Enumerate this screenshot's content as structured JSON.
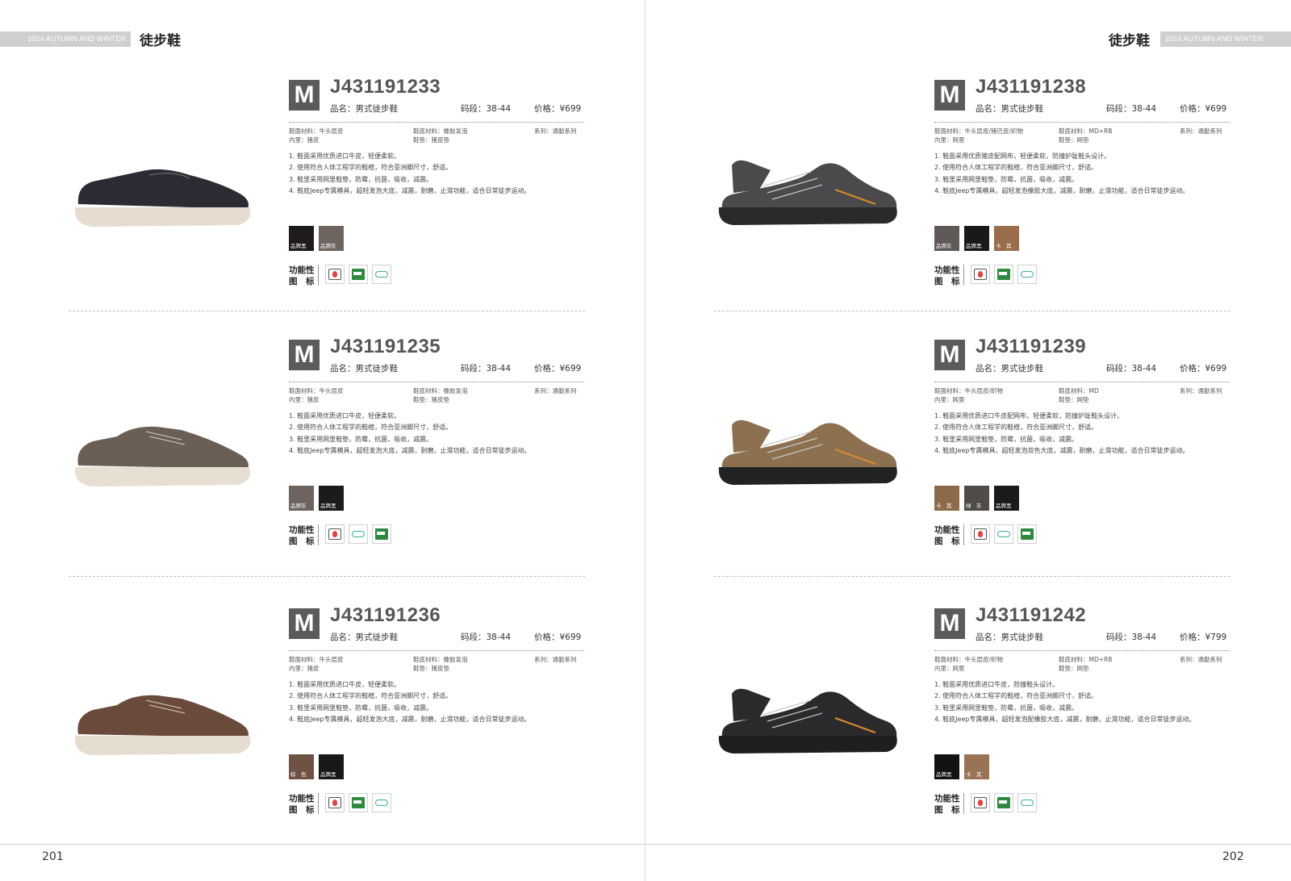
{
  "header": {
    "season_label": "2024 AUTUMN AND WINTER",
    "category_title": "徒步鞋"
  },
  "pages": {
    "left": {
      "number": "201"
    },
    "right": {
      "number": "202"
    }
  },
  "products": [
    {
      "badge": "M",
      "code": "J431191233",
      "name": "品名：男式徒步鞋",
      "size": "码段：38-44",
      "price": "价格：¥699",
      "upper": "鞋面材料：牛头层皮",
      "lining": "内里：猪皮",
      "sole": "鞋底材料：橡胶发泡",
      "insole": "鞋垫：猪皮垫",
      "series": "系列：通勤系列",
      "features": [
        "1. 鞋面采用优质进口牛皮，轻便柔软。",
        "2. 使用符合人体工程学的鞋楦，符合亚洲脚尺寸，舒适。",
        "3. 鞋里采用网里鞋垫，防霉，抗菌，吸收，减震。",
        "4. 鞋底Jeep专属模具，超轻发泡大底，减震，耐磨，止滑功能，适合日常徒步运动。"
      ],
      "colors": [
        {
          "label": "品牌黑",
          "hex": "#1f1b1d"
        },
        {
          "label": "品牌灰",
          "hex": "#6f6560"
        }
      ],
      "function_label": [
        "功能性",
        "图　标"
      ],
      "icons": [
        "anti-icon",
        "aegis-icon",
        "light-icon"
      ],
      "shoe": {
        "upper": "#2b2c33",
        "sole": "#e6ddd0",
        "style": "loafer"
      }
    },
    {
      "badge": "M",
      "code": "J431191235",
      "name": "品名：男式徒步鞋",
      "size": "码段：38-44",
      "price": "价格：¥699",
      "upper": "鞋面材料：牛头层皮",
      "lining": "内里：猪皮",
      "sole": "鞋底材料：橡胶发泡",
      "insole": "鞋垫：猪皮垫",
      "series": "系列：通勤系列",
      "features": [
        "1. 鞋面采用优质进口牛皮，轻便柔软。",
        "2. 使用符合人体工程学的鞋楦，符合亚洲脚尺寸，舒适。",
        "3. 鞋里采用网里鞋垫，防霉，抗菌，吸收，减震。",
        "4. 鞋底Jeep专属模具，超轻发泡大底，减震，耐磨，止滑功能，适合日常徒步运动。"
      ],
      "colors": [
        {
          "label": "品牌灰",
          "hex": "#6d6460"
        },
        {
          "label": "品牌黑",
          "hex": "#1c1a1c"
        }
      ],
      "function_label": [
        "功能性",
        "图　标"
      ],
      "icons": [
        "anti-icon",
        "light-icon",
        "aegis-icon"
      ],
      "shoe": {
        "upper": "#6b5f55",
        "sole": "#e7dfd2",
        "style": "lace"
      }
    },
    {
      "badge": "M",
      "code": "J431191236",
      "name": "品名：男式徒步鞋",
      "size": "码段：38-44",
      "price": "价格：¥699",
      "upper": "鞋面材料：牛头层皮",
      "lining": "内里：猪皮",
      "sole": "鞋底材料：橡胶发泡",
      "insole": "鞋垫：猪皮垫",
      "series": "系列：通勤系列",
      "features": [
        "1. 鞋面采用优质进口牛皮，轻便柔软。",
        "2. 使用符合人体工程学的鞋楦，符合亚洲脚尺寸，舒适。",
        "3. 鞋里采用网里鞋垫，防霉，抗菌，吸收，减震。",
        "4. 鞋底Jeep专属模具，超轻发泡大底，减震，耐磨，止滑功能，适合日常徒步运动。"
      ],
      "colors": [
        {
          "label": "棕　色",
          "hex": "#6e5244"
        },
        {
          "label": "品牌黑",
          "hex": "#191719"
        }
      ],
      "function_label": [
        "功能性",
        "图　标"
      ],
      "icons": [
        "anti-icon",
        "aegis-icon",
        "light-icon"
      ],
      "shoe": {
        "upper": "#6a4a3a",
        "sole": "#e5ddd0",
        "style": "lace"
      }
    },
    {
      "badge": "M",
      "code": "J431191238",
      "name": "品名：男式徒步鞋",
      "size": "码段：38-44",
      "price": "价格：¥699",
      "upper": "鞋面材料：牛头层皮/猪巴皮/织物",
      "lining": "内里：网里",
      "sole": "鞋底材料：MD+RB",
      "insole": "鞋垫：网垫",
      "series": "系列：通勤系列",
      "features": [
        "1. 鞋面采用优质猪皮配网布，轻便柔软，防撞护趾鞋头设计。",
        "2. 使用符合人体工程学的鞋楦，符合亚洲脚尺寸，舒适。",
        "3. 鞋里采用网里鞋垫，防霉，抗菌，吸收，减震。",
        "4. 鞋底Jeep专属模具，超轻发泡橡胶大底，减震，耐磨，止滑功能，适合日常徒步运动。"
      ],
      "colors": [
        {
          "label": "品牌灰",
          "hex": "#5f5a58"
        },
        {
          "label": "品牌黑",
          "hex": "#1a1819"
        },
        {
          "label": "卡　其",
          "hex": "#9a6e4c"
        }
      ],
      "function_label": [
        "功能性",
        "图　标"
      ],
      "icons": [
        "anti-icon",
        "aegis-icon",
        "light-icon"
      ],
      "shoe": {
        "upper": "#4a4a4c",
        "sole": "#2a2a2a",
        "style": "hiker"
      }
    },
    {
      "badge": "M",
      "code": "J431191239",
      "name": "品名：男式徒步鞋",
      "size": "码段：38-44",
      "price": "价格：¥699",
      "upper": "鞋面材料：牛头层皮/织物",
      "lining": "内里：网里",
      "sole": "鞋底材料：MD",
      "insole": "鞋垫：网垫",
      "series": "系列：通勤系列",
      "features": [
        "1. 鞋面采用优质进口牛皮配网布，轻便柔软，防撞护趾鞋头设计。",
        "2. 使用符合人体工程学的鞋楦，符合亚洲脚尺寸，舒适。",
        "3. 鞋里采用网里鞋垫，防霉，抗菌，吸收，减震。",
        "4. 鞋底Jeep专属模具，超轻发泡双色大底，减震，耐磨，止滑功能，适合日常徒步运动。"
      ],
      "colors": [
        {
          "label": "卡　其",
          "hex": "#8e6a4c"
        },
        {
          "label": "绿　灰",
          "hex": "#4f4b47"
        },
        {
          "label": "品牌黑",
          "hex": "#1b191a"
        }
      ],
      "function_label": [
        "功能性",
        "图　标"
      ],
      "icons": [
        "anti-icon",
        "light-icon",
        "aegis-icon"
      ],
      "shoe": {
        "upper": "#8c7050",
        "sole": "#222222",
        "style": "hiker"
      }
    },
    {
      "badge": "M",
      "code": "J431191242",
      "name": "品名：男式徒步鞋",
      "size": "码段：38-44",
      "price": "价格：¥799",
      "upper": "鞋面材料：牛头层皮/织物",
      "lining": "内里：网里",
      "sole": "鞋底材料：MD+RB",
      "insole": "鞋垫：网垫",
      "series": "系列：通勤系列",
      "features": [
        "1. 鞋面采用优质进口牛皮，防撞鞋头设计。",
        "2. 使用符合人体工程学的鞋楦，符合亚洲脚尺寸，舒适。",
        "3. 鞋里采用网里鞋垫，防霉，抗菌，吸收，减震。",
        "4. 鞋底Jeep专属模具，超轻发泡配橡胶大底，减震，耐磨，止滑功能，适合日常徒步运动。"
      ],
      "colors": [
        {
          "label": "品牌黑",
          "hex": "#141213"
        },
        {
          "label": "卡　其",
          "hex": "#9a7354"
        }
      ],
      "function_label": [
        "功能性",
        "图　标"
      ],
      "icons": [
        "anti-icon",
        "aegis-icon",
        "light-icon"
      ],
      "shoe": {
        "upper": "#2a2a2c",
        "sole": "#1f1f1f",
        "style": "hiker"
      }
    }
  ]
}
